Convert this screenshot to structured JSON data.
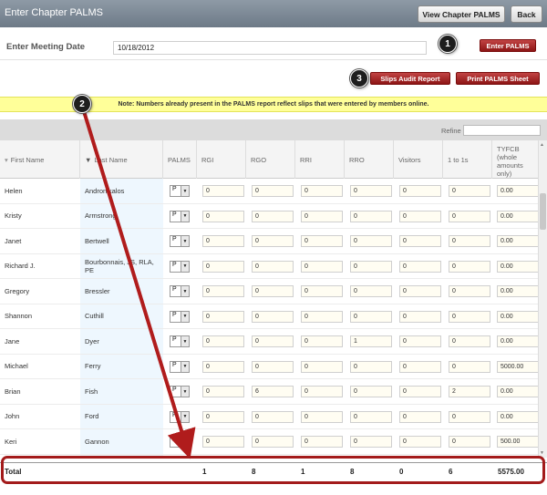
{
  "header": {
    "title": "Enter Chapter PALMS",
    "view_button": "View Chapter PALMS",
    "back_button": "Back"
  },
  "meeting": {
    "label": "Enter Meeting Date",
    "date_value": "10/18/2012",
    "enter_button": "Enter PALMS"
  },
  "actions": {
    "slips_audit_button": "Slips Audit Report",
    "print_button": "Print PALMS Sheet"
  },
  "callouts": [
    "1",
    "2",
    "3"
  ],
  "note": "Note: Numbers already present in the PALMS report reflect slips that were entered by members online.",
  "filter": {
    "label": "Refine"
  },
  "table": {
    "columns": [
      "First Name",
      "Last Name",
      "PALMS",
      "RGI",
      "RGO",
      "RRI",
      "RRO",
      "Visitors",
      "1 to 1s",
      "TYFCB (whole amounts only)"
    ],
    "rows": [
      {
        "first": "Helen",
        "last": "Andronikalos",
        "palms": "P",
        "rgi": "0",
        "rgo": "0",
        "rri": "0",
        "rro": "0",
        "visitors": "0",
        "one2one": "0",
        "tyfcb": "0.00"
      },
      {
        "first": "Kristy",
        "last": "Armstrong",
        "palms": "P",
        "rgi": "0",
        "rgo": "0",
        "rri": "0",
        "rro": "0",
        "visitors": "0",
        "one2one": "0",
        "tyfcb": "0.00"
      },
      {
        "first": "Janet",
        "last": "Bertwell",
        "palms": "P",
        "rgi": "0",
        "rgo": "0",
        "rri": "0",
        "rro": "0",
        "visitors": "0",
        "one2one": "0",
        "tyfcb": "0.00"
      },
      {
        "first": "Richard J.",
        "last": "Bourbonnais, JS, RLA, PE",
        "palms": "P",
        "rgi": "0",
        "rgo": "0",
        "rri": "0",
        "rro": "0",
        "visitors": "0",
        "one2one": "0",
        "tyfcb": "0.00"
      },
      {
        "first": "Gregory",
        "last": "Bressler",
        "palms": "P",
        "rgi": "0",
        "rgo": "0",
        "rri": "0",
        "rro": "0",
        "visitors": "0",
        "one2one": "0",
        "tyfcb": "0.00"
      },
      {
        "first": "Shannon",
        "last": "Cuthill",
        "palms": "P",
        "rgi": "0",
        "rgo": "0",
        "rri": "0",
        "rro": "0",
        "visitors": "0",
        "one2one": "0",
        "tyfcb": "0.00"
      },
      {
        "first": "Jane",
        "last": "Dyer",
        "palms": "P",
        "rgi": "0",
        "rgo": "0",
        "rri": "0",
        "rro": "1",
        "visitors": "0",
        "one2one": "0",
        "tyfcb": "0.00"
      },
      {
        "first": "Michael",
        "last": "Ferry",
        "palms": "P",
        "rgi": "0",
        "rgo": "0",
        "rri": "0",
        "rro": "0",
        "visitors": "0",
        "one2one": "0",
        "tyfcb": "5000.00"
      },
      {
        "first": "Brian",
        "last": "Fish",
        "palms": "P",
        "rgi": "0",
        "rgo": "6",
        "rri": "0",
        "rro": "0",
        "visitors": "0",
        "one2one": "2",
        "tyfcb": "0.00"
      },
      {
        "first": "John",
        "last": "Ford",
        "palms": "P",
        "rgi": "0",
        "rgo": "0",
        "rri": "0",
        "rro": "0",
        "visitors": "0",
        "one2one": "0",
        "tyfcb": "0.00"
      },
      {
        "first": "Keri",
        "last": "Gannon",
        "palms": "P",
        "rgi": "0",
        "rgo": "0",
        "rri": "0",
        "rro": "0",
        "visitors": "0",
        "one2one": "0",
        "tyfcb": "500.00"
      }
    ],
    "total": {
      "label": "Total",
      "rgi": "1",
      "rgo": "8",
      "rri": "1",
      "rro": "8",
      "visitors": "0",
      "one2one": "6",
      "tyfcb": "5575.00"
    }
  },
  "colors": {
    "accent_red": "#a31b1b",
    "note_bg": "#ffff99",
    "header_bg": "#7a8794"
  }
}
